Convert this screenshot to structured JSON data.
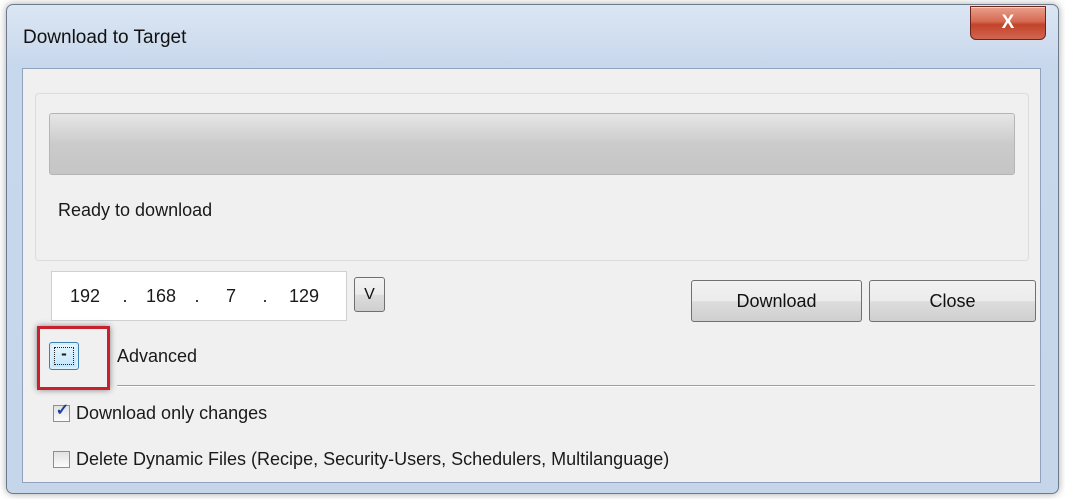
{
  "window": {
    "title": "Download to Target",
    "close_glyph": "X"
  },
  "progress": {
    "value": 0,
    "status_text": "Ready to download"
  },
  "ip_address": {
    "octets": [
      "192",
      "168",
      "7",
      "129"
    ],
    "separator": "."
  },
  "buttons": {
    "version_label": "V",
    "download_label": "Download",
    "close_label": "Close"
  },
  "advanced": {
    "toggle_label": "-",
    "label": "Advanced",
    "highlight_color": "#c8202c"
  },
  "options": {
    "download_only_changes": {
      "label": "Download only changes",
      "checked": true
    },
    "delete_dynamic_files": {
      "label": "Delete Dynamic Files (Recipe, Security-Users, Schedulers, Multilanguage)",
      "checked": false
    }
  }
}
